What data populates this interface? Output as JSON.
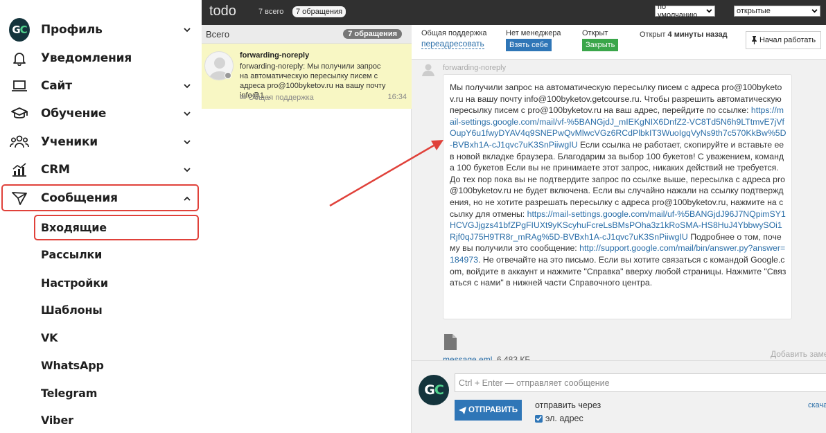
{
  "sidebar": {
    "items": [
      {
        "label": "Профиль",
        "icon": "gc-logo-icon"
      },
      {
        "label": "Уведомления",
        "icon": "bell-icon"
      },
      {
        "label": "Сайт",
        "icon": "laptop-icon"
      },
      {
        "label": "Обучение",
        "icon": "graduation-cap-icon"
      },
      {
        "label": "Ученики",
        "icon": "users-icon"
      },
      {
        "label": "CRM",
        "icon": "chart-icon"
      },
      {
        "label": "Сообщения",
        "icon": "send-icon"
      }
    ],
    "logo_text": "GC",
    "subitems": [
      "Входящие",
      "Рассылки",
      "Настройки",
      "Шаблоны",
      "VK",
      "WhatsApp",
      "Telegram",
      "Viber"
    ]
  },
  "topbar": {
    "title": "todo",
    "count_all": "7 всего",
    "count_badge": "7 обращения",
    "sort_select": "по умолчанию",
    "status_select": "открытые"
  },
  "list": {
    "title": "Всего",
    "badge": "7 обращения",
    "conversation": {
      "name": "forwarding-noreply",
      "snippet": "forwarding-noreply: Мы получили запрос на автоматическую пересылку писем с адреса pro@100byketov.ru на вашу почту info@1...",
      "department": "Общая поддержка",
      "time": "16:34"
    }
  },
  "detail": {
    "department_label": "Общая поддержка",
    "reassign_link": "переадресовать",
    "manager_label": "Нет менеджера",
    "take_button": "Взять себе",
    "status_label": "Открыт",
    "close_button": "Закрыть",
    "opened_prefix": "Открыт",
    "opened_ago": "4 минуты назад",
    "start_button": "Начал работать",
    "message": {
      "author": "forwarding-noreply",
      "text_1": "Мы получили запрос на автоматическую пересылку писем с адреса pro@100byketov.ru на вашу почту info@100byketov.getcourse.ru. Чтобы разрешить автоматическую пересылку писем с pro@100byketov.ru на ваш адрес, перейдите по ссылке: ",
      "link_1": "https://mail-settings.google.com/mail/vf-%5BANGjdJ_mIEKgNIX6DnfZ2-VC8Td5N6h9LTtmvE7jVfOupY6u1fwyDYAV4q9SNEPwQvMlwcVGz6RCdPlbkIT3WuoIgqVyNs9th7c570KkBw%5D-BVBxh1A-cJ1qvc7uK3SnPiiwgIU",
      "text_2": " Если ссылка не работает, скопируйте и вставьте ее в новой вкладке браузера. Благодарим за выбор 100 букетов! С уважением, команда 100 букетов Если вы не принимаете этот запрос, никаких действий не требуется. До тех пор пока вы не подтвердите запрос по ссылке выше, пересылка с адреса pro@100byketov.ru не будет включена. Если вы случайно нажали на ссылку подтверждения, но не хотите разрешать пересылку с адреса pro@100byketov.ru, нажмите на ссылку для отмены: ",
      "link_2": "https://mail-settings.google.com/mail/uf-%5BANGjdJ96J7NQpimSY1HCVGJjgzs41bfZPgFIUXt9yKScyhuFcreLsBMsPOha3z1kRoSMA-HS8HuJ4YbbwySOi1Rjf0qJ75H9TR8r_mRAg%5D-BVBxh1A-cJ1qvc7uK3SnPiiwgIU",
      "text_3": " Подробнее о том, почему вы получили это сообщение: ",
      "link_3": "http://support.google.com/mail/bin/answer.py?answer=184973",
      "text_4": ". Не отвечайте на это письмо. Если вы хотите связаться с командой Google.com, войдите в аккаунт и нажмите \"Справка\" вверху любой страницы. Нажмите \"Связаться с нами\" в нижней части Справочного центра."
    },
    "attachment": {
      "name": "message.eml",
      "size": "6,483 КБ"
    },
    "add_note": "Добавить заметку"
  },
  "composer": {
    "logo_text": "GC",
    "placeholder": "Ctrl + Enter — отправляет сообщение",
    "send_button": "ОТПРАВИТЬ",
    "send_via": "отправить через",
    "channel": "эл. адрес",
    "download_link": "скачать"
  },
  "colors": {
    "highlight": "#e0413a",
    "primary": "#2f76b7",
    "success": "#3aa64a",
    "topbar": "#303030",
    "selected_row": "#f8f7c4",
    "logo": "#14343c",
    "logo_accent": "#4fd08c"
  }
}
